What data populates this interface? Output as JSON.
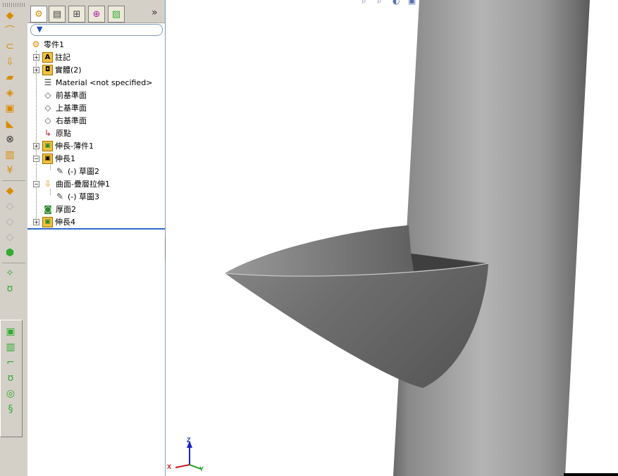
{
  "left_toolbar": {
    "items": [
      "extrude-icon",
      "revolve-icon",
      "sweep-icon",
      "loft-icon",
      "boundary-icon",
      "fillet-icon",
      "shell-icon",
      "rib-icon",
      "draft-icon",
      "wrap-icon",
      "dome-icon",
      "mirror-icon",
      "pattern-icon",
      "curve-icon",
      "ruled-surface-icon",
      "plane-icon",
      "spline-icon",
      "helix-icon",
      "split-line-icon",
      "projected-curve-icon"
    ]
  },
  "feature_manager": {
    "tabs": [
      "featuremanager-tab",
      "propertymanager-tab",
      "configurationmanager-tab",
      "dimxpert-tab",
      "display-manager-tab"
    ],
    "expand_glyph": "»",
    "tree": [
      {
        "label": "零件1",
        "icon": "part-icon",
        "expander": ""
      },
      {
        "label": "註記",
        "icon": "annotations-icon",
        "expander": "+"
      },
      {
        "label": "實體(2)",
        "icon": "solid-bodies-icon",
        "expander": "+"
      },
      {
        "label": "Material <not specified>",
        "icon": "material-icon",
        "expander": ""
      },
      {
        "label": "前基準面",
        "icon": "plane-icon",
        "expander": ""
      },
      {
        "label": "上基準面",
        "icon": "plane-icon",
        "expander": ""
      },
      {
        "label": "右基準面",
        "icon": "plane-icon",
        "expander": ""
      },
      {
        "label": "原點",
        "icon": "origin-icon",
        "expander": ""
      },
      {
        "label": "伸長-薄件1",
        "icon": "extrude-thin-icon",
        "expander": "+"
      },
      {
        "label": "伸長1",
        "icon": "extrude-icon",
        "expander": "−"
      },
      {
        "label": "(-) 草圖2",
        "icon": "sketch-icon",
        "expander": ""
      },
      {
        "label": "曲面-疊層拉伸1",
        "icon": "surface-loft-icon",
        "expander": "−"
      },
      {
        "label": "(-) 草圖3",
        "icon": "sketch-icon",
        "expander": ""
      },
      {
        "label": "厚面2",
        "icon": "thicken-icon",
        "expander": ""
      },
      {
        "label": "伸長4",
        "icon": "extrude-icon",
        "expander": "+"
      }
    ]
  },
  "viewport": {
    "triad": {
      "z": "Z",
      "x": "X",
      "y": "Y"
    },
    "colors": {
      "cylinder_dark": "#5f5f5f",
      "cylinder_light": "#b8b8b8",
      "cone": "#7a7a7a",
      "triad_z": "#1a22c8",
      "triad_x": "#c81a1a",
      "triad_y": "#1a9a1a"
    }
  }
}
